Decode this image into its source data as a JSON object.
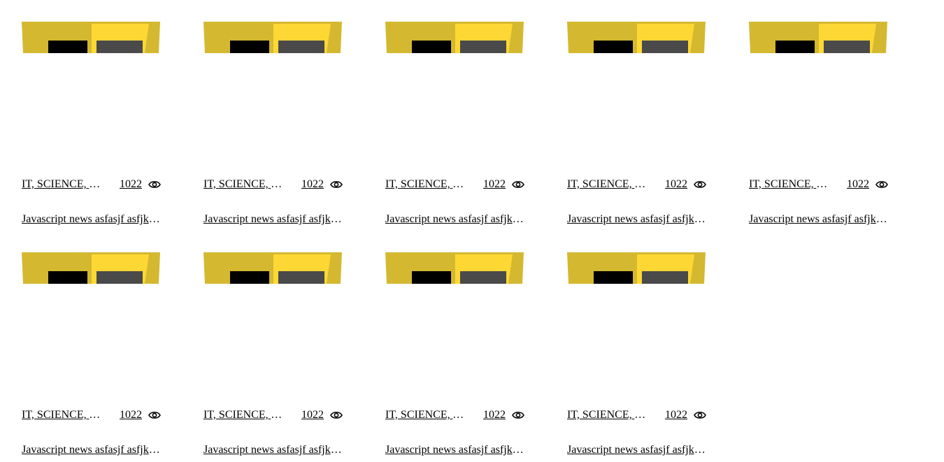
{
  "colors": {
    "thumb_left": "#D4B830",
    "thumb_right": "#FDD835",
    "thumb_dark": "#000000",
    "thumb_gray": "#4A4A4A"
  },
  "icons": {
    "views": "eye-icon"
  },
  "cards": [
    {
      "tags": "IT, SCIENCE, TECH",
      "views": "1022",
      "title": "Javascript news asfasjf asfjkasfjk asfjk"
    },
    {
      "tags": "IT, SCIENCE, TECH",
      "views": "1022",
      "title": "Javascript news asfasjf asfjkasfjk asfjk"
    },
    {
      "tags": "IT, SCIENCE, TECH",
      "views": "1022",
      "title": "Javascript news asfasjf asfjkasfjk asfjk"
    },
    {
      "tags": "IT, SCIENCE, TECH",
      "views": "1022",
      "title": "Javascript news asfasjf asfjkasfjk asfjk"
    },
    {
      "tags": "IT, SCIENCE, TECH",
      "views": "1022",
      "title": "Javascript news asfasjf asfjkasfjk asfjk"
    },
    {
      "tags": "IT, SCIENCE, TECH",
      "views": "1022",
      "title": "Javascript news asfasjf asfjkasfjk asfjk"
    },
    {
      "tags": "IT, SCIENCE, TECH",
      "views": "1022",
      "title": "Javascript news asfasjf asfjkasfjk asfjk"
    },
    {
      "tags": "IT, SCIENCE, TECH",
      "views": "1022",
      "title": "Javascript news asfasjf asfjkasfjk asfjk"
    },
    {
      "tags": "IT, SCIENCE, TECH",
      "views": "1022",
      "title": "Javascript news asfasjf asfjkasfjk asfjk"
    }
  ]
}
